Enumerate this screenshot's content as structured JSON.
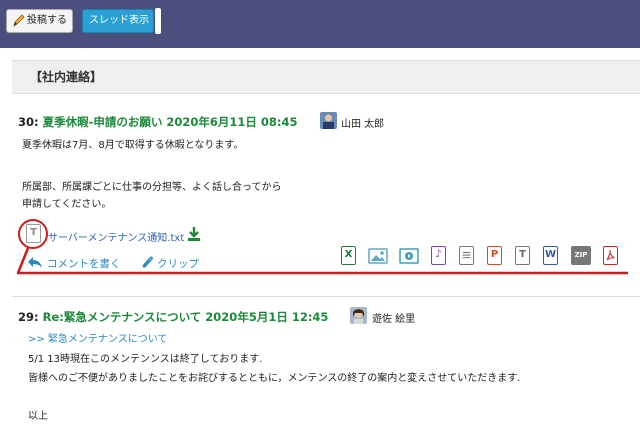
{
  "toolbar": {
    "post_label": "投稿する",
    "thread_label": "スレッド表示"
  },
  "section": {
    "title": "【社内連絡】"
  },
  "posts": [
    {
      "num": "30:",
      "title": "夏季休暇-申請のお願い 2020年6月11日 08:45",
      "author": "山田 太郎",
      "lines": [
        "夏季休暇は7月、8月で取得する休暇となります。",
        "所属部、所属課ごとに仕事の分担等、よく話し合ってから",
        "申請してください。"
      ],
      "attachment": "サーバーメンテナンス通知.txt",
      "comment_label": "コメントを書く",
      "clip_label": "クリップ"
    },
    {
      "num": "29:",
      "title": "Re:緊急メンテナンスについて 2020年5月1日 12:45",
      "author": "遊佐 絵里",
      "quote": ">> 緊急メンテナンスについて",
      "lines": [
        "5/1 13時現在このメンテンンスは終了しております.",
        "皆様へのご不便がありましたことをお詫びするとともに，メンテンスの終了の案内と変えさせていただきます.",
        "以上"
      ]
    }
  ],
  "file_icons": [
    {
      "name": "excel-icon",
      "glyph": "X",
      "color": "#1d7a3a"
    },
    {
      "name": "image-icon",
      "glyph": "",
      "color": "#5fa8c8"
    },
    {
      "name": "video-icon",
      "glyph": "",
      "color": "#3aa0b8"
    },
    {
      "name": "music-icon",
      "glyph": "♪",
      "color": "#8a3ab8"
    },
    {
      "name": "document-icon",
      "glyph": "",
      "color": "#777777"
    },
    {
      "name": "powerpoint-icon",
      "glyph": "P",
      "color": "#d04a1a"
    },
    {
      "name": "text-icon",
      "glyph": "T",
      "color": "#777777"
    },
    {
      "name": "word-icon",
      "glyph": "W",
      "color": "#2a5aa8"
    },
    {
      "name": "zip-icon",
      "glyph": "ZIP",
      "color": "#666666"
    },
    {
      "name": "pdf-icon",
      "glyph": "",
      "color": "#d02020"
    }
  ],
  "colors": {
    "header_bg": "#4b4f7e",
    "accent_blue": "#2aa0d4",
    "title_green": "#1a8a3a",
    "highlight_red": "#cc1c1c"
  }
}
